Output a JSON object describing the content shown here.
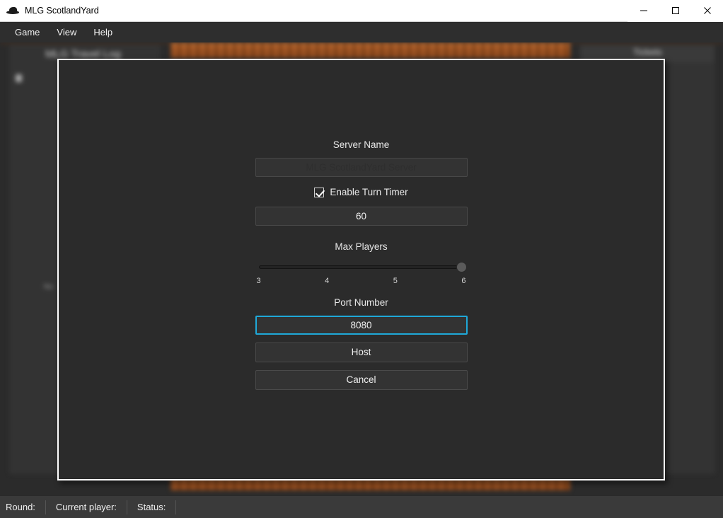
{
  "window": {
    "title": "MLG ScotlandYard",
    "icon": "detective-hat-icon",
    "controls": {
      "minimize": "—",
      "maximize": "□",
      "close": "✕"
    }
  },
  "menubar": {
    "items": [
      {
        "label": "Game"
      },
      {
        "label": "View"
      },
      {
        "label": "Help"
      }
    ]
  },
  "background": {
    "travel_log_title": "MLG Travel Log",
    "tickets_title": "Tickets",
    "small_text": "No"
  },
  "dialog": {
    "server_name": {
      "label": "Server Name",
      "value": "MLG ScotlandYard Server",
      "placeholder": "MLG ScotlandYard Server"
    },
    "turn_timer": {
      "checkbox_label": "Enable Turn Timer",
      "checked": true,
      "value": "60",
      "placeholder": "60"
    },
    "max_players": {
      "label": "Max Players",
      "value": 6,
      "min": 3,
      "max": 6,
      "ticks": [
        "3",
        "4",
        "5",
        "6"
      ]
    },
    "port_number": {
      "label": "Port Number",
      "value": "8080",
      "placeholder": "8080",
      "focused": true,
      "focus_color": "#1fa8d8"
    },
    "buttons": {
      "host": "Host",
      "cancel": "Cancel"
    }
  },
  "statusbar": {
    "round_label": "Round:",
    "current_player_label": "Current player:",
    "status_label": "Status:"
  }
}
